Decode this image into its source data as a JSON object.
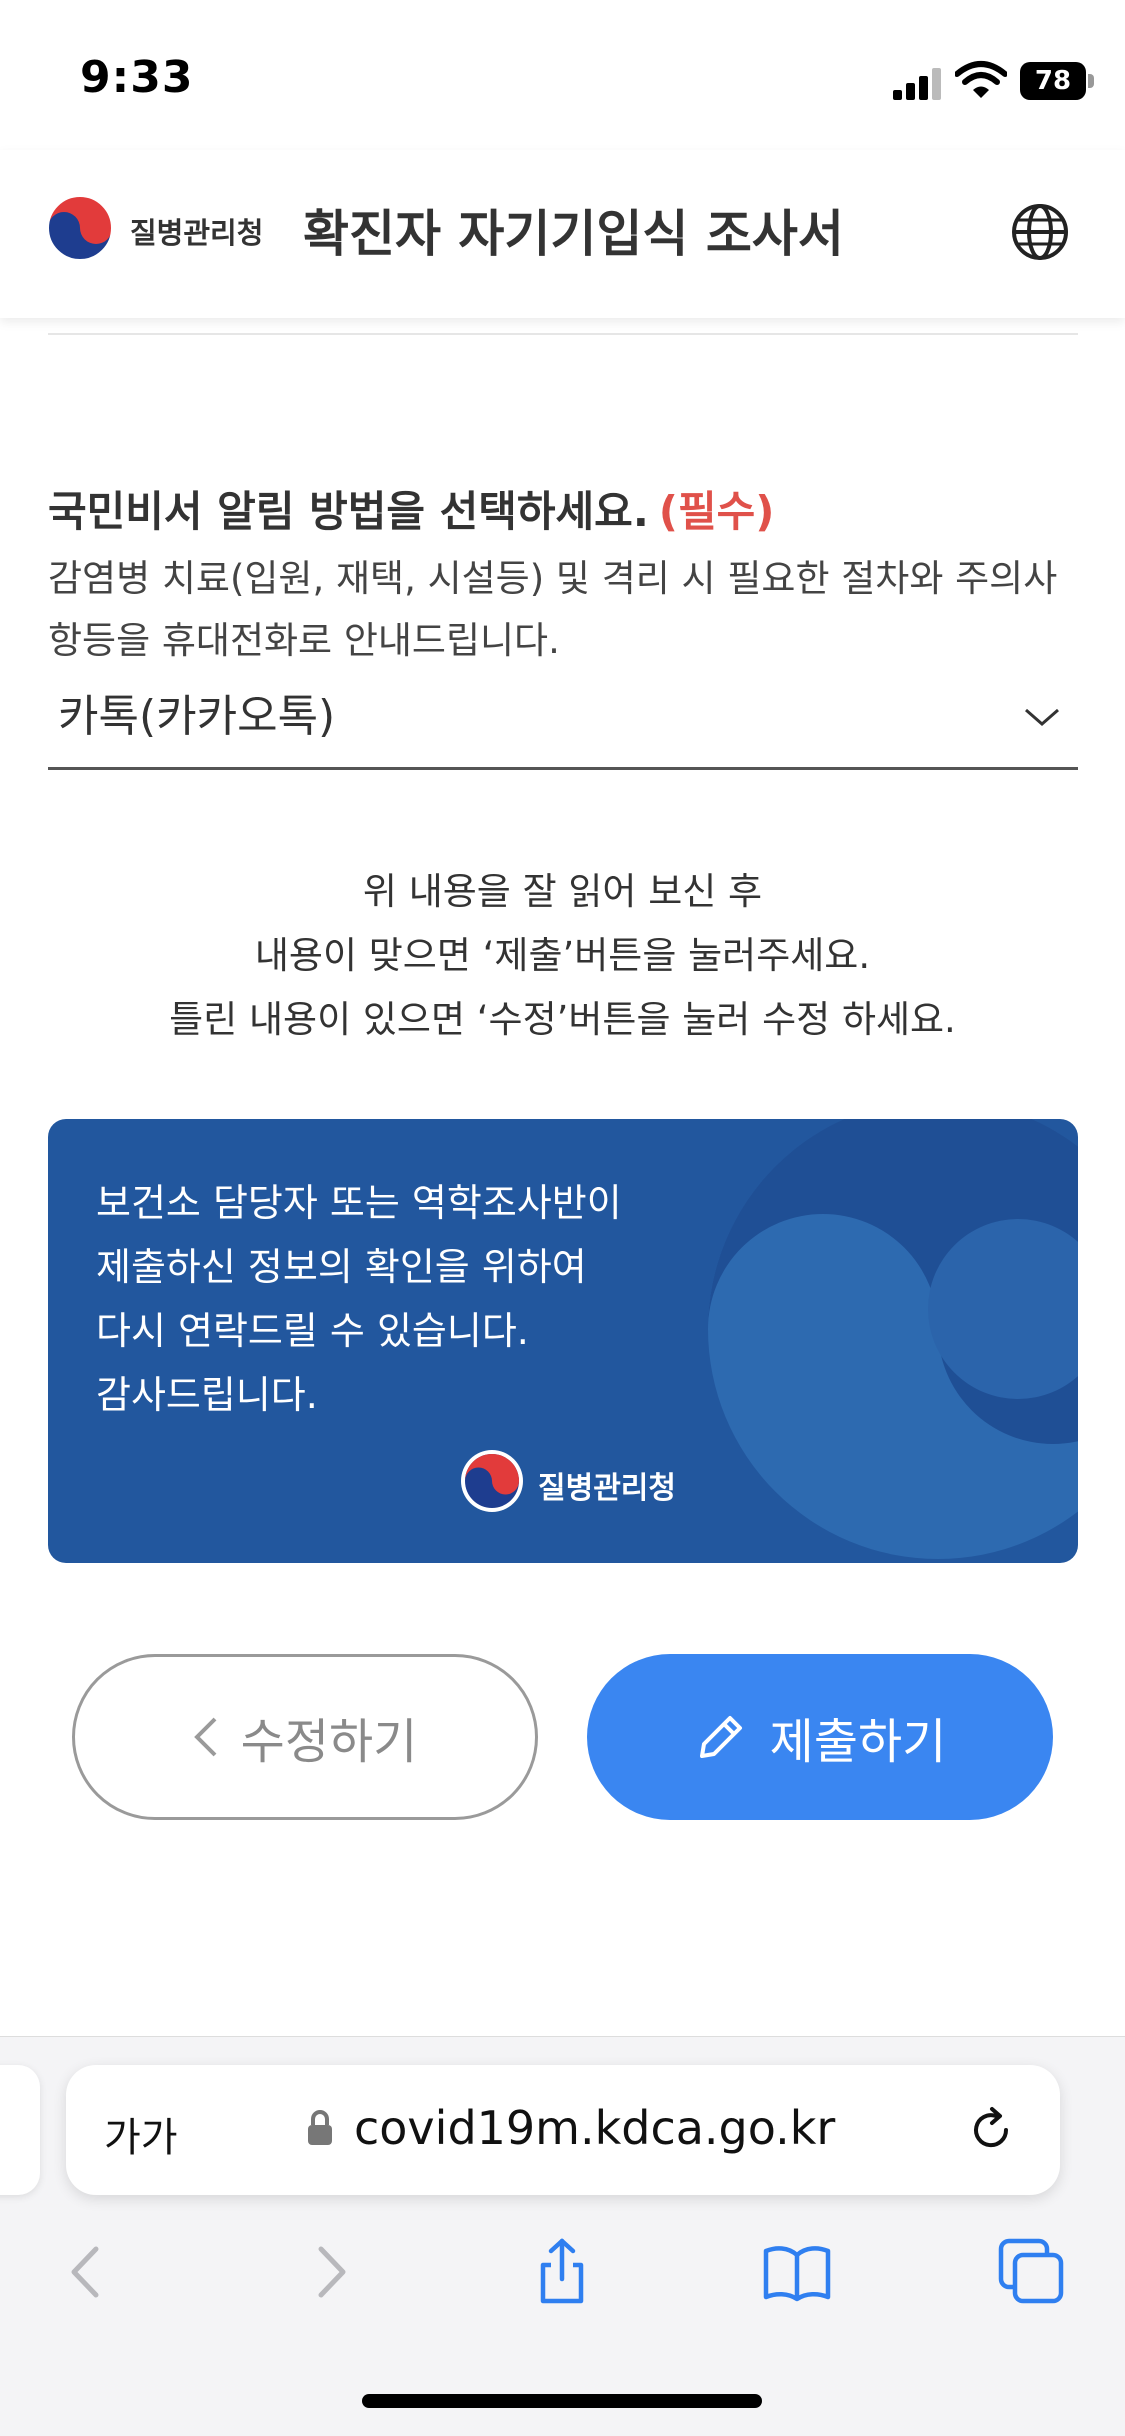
{
  "status_bar": {
    "time": "9:33",
    "battery": "78"
  },
  "header": {
    "logo_text": "질병관리청",
    "title": "확진자 자기기입식 조사서"
  },
  "question": {
    "title": "국민비서 알림 방법을 선택하세요.",
    "required_label": "(필수)",
    "description": "감염병 치료(입원, 재택, 시설등) 및 격리 시 필요한 절차와 주의사항등을 휴대전화로 안내드립니다.",
    "selected_value": "카톡(카카오톡)"
  },
  "notice": {
    "lines": [
      "위 내용을 잘 읽어 보신 후",
      "내용이 맞으면 ‘제출’버튼을 눌러주세요.",
      "틀린 내용이 있으면 ‘수정’버튼을 눌러 수정 하세요."
    ]
  },
  "info_card": {
    "lines": [
      "보건소 담당자 또는 역학조사반이",
      "제출하신 정보의 확인을 위하여",
      "다시 연락드릴 수 있습니다.",
      "감사드립니다."
    ],
    "logo_text": "질병관리청"
  },
  "buttons": {
    "edit_label": "수정하기",
    "submit_label": "제출하기"
  },
  "browser": {
    "text_size_label": "가가",
    "url": "covid19m.kdca.go.kr"
  },
  "colors": {
    "accent_blue": "#3a86f1",
    "card_blue": "#22579e",
    "required_red": "#e0514a"
  }
}
